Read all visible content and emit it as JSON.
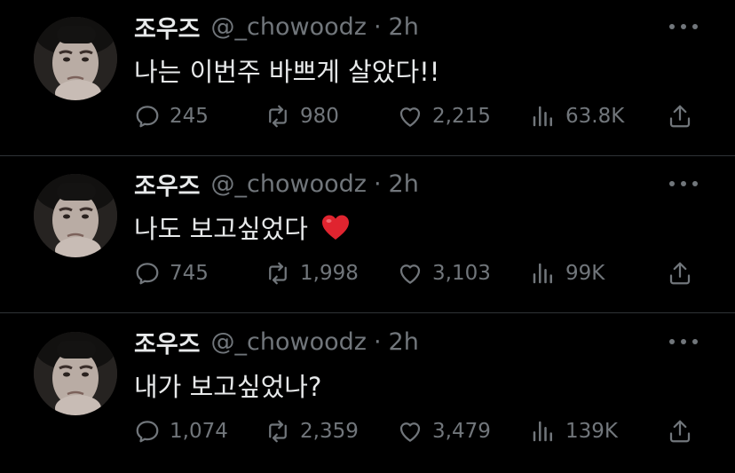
{
  "tweets": [
    {
      "display_name": "조우즈",
      "handle": "@_chowoodz",
      "separator": "·",
      "time": "2h",
      "text": "나는 이번주 바쁘게 살았다!!",
      "has_heart_emoji": false,
      "replies": "245",
      "retweets": "980",
      "likes": "2,215",
      "views": "63.8K"
    },
    {
      "display_name": "조우즈",
      "handle": "@_chowoodz",
      "separator": "·",
      "time": "2h",
      "text": "나도 보고싶었다",
      "has_heart_emoji": true,
      "replies": "745",
      "retweets": "1,998",
      "likes": "3,103",
      "views": "99K"
    },
    {
      "display_name": "조우즈",
      "handle": "@_chowoodz",
      "separator": "·",
      "time": "2h",
      "text": "내가 보고싶었나?",
      "has_heart_emoji": false,
      "replies": "1,074",
      "retweets": "2,359",
      "likes": "3,479",
      "views": "139K"
    }
  ],
  "icons": {
    "reply": "reply-icon",
    "retweet": "retweet-icon",
    "like": "like-icon",
    "views": "views-icon",
    "share": "share-icon",
    "more": "more-icon",
    "emoji": "red-heart-emoji"
  },
  "colors": {
    "background": "#000000",
    "text_primary": "#e7e9ea",
    "text_secondary": "#71767b",
    "divider": "#2f3336",
    "heart_emoji": "#e0242f"
  }
}
